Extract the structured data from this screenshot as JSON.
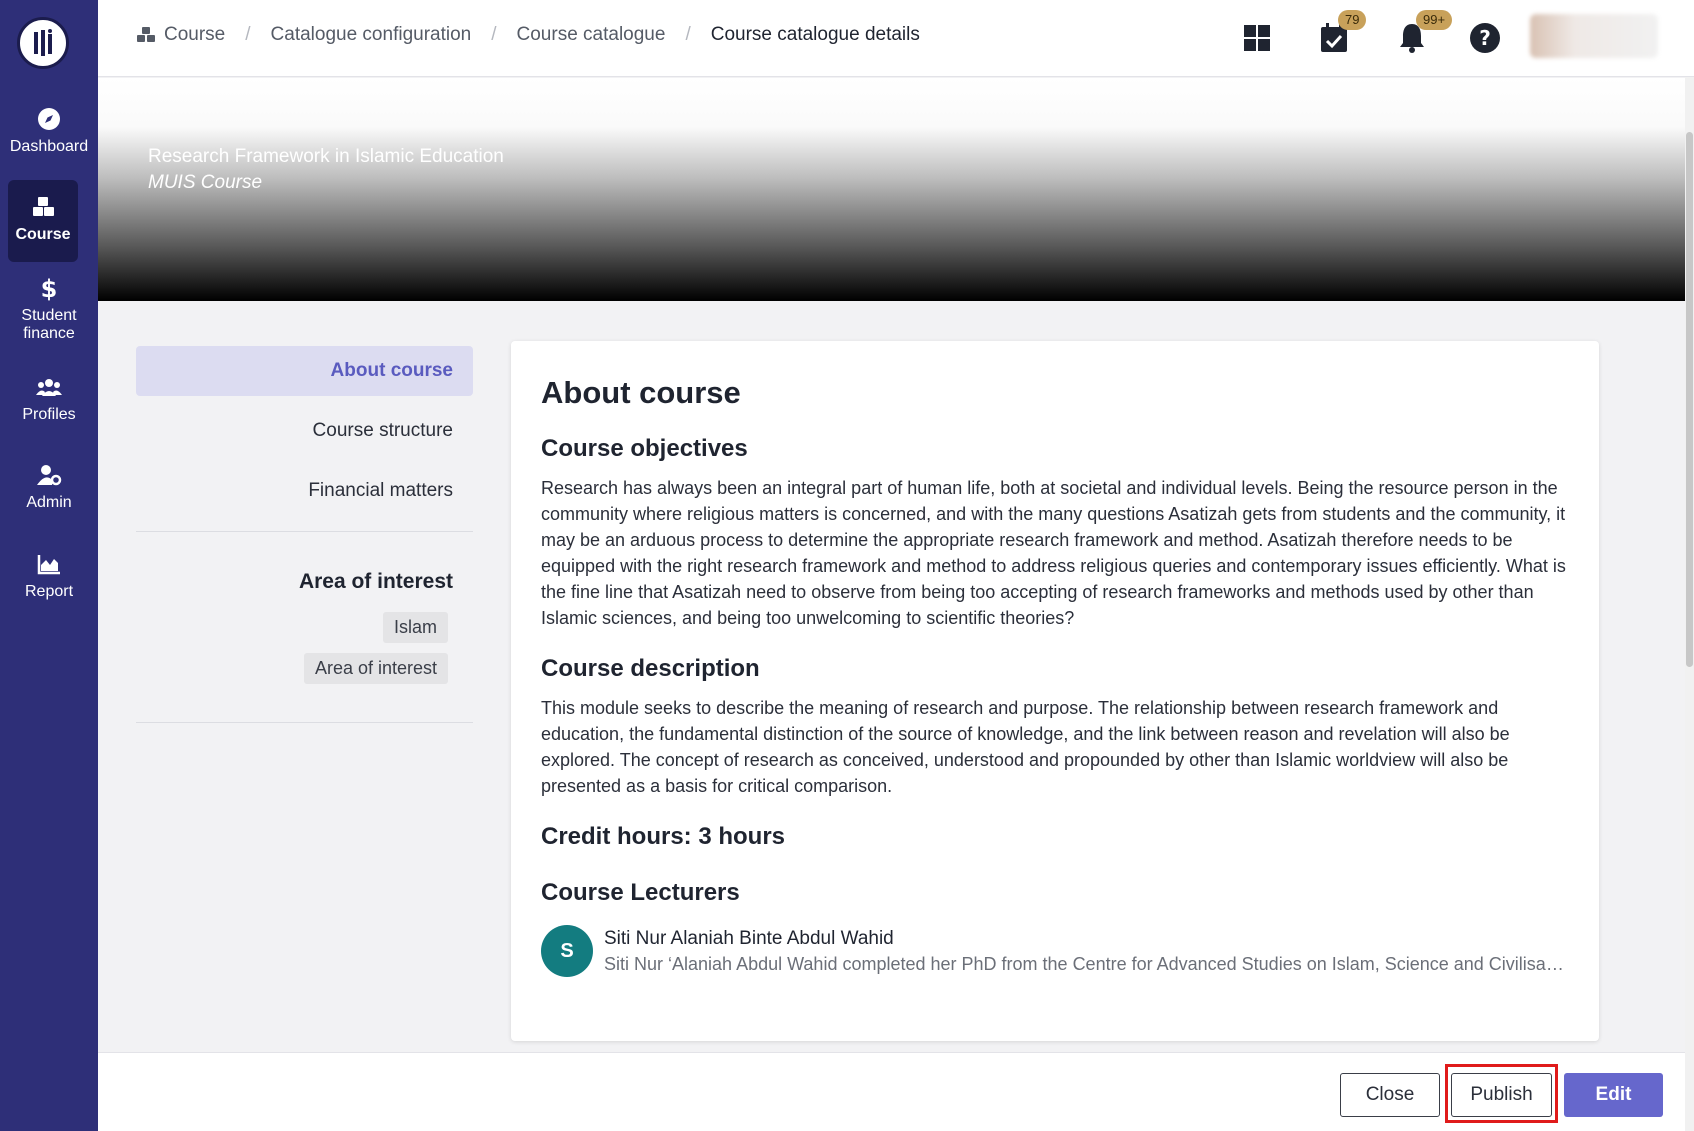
{
  "sidebar": {
    "items": [
      {
        "label": "Dashboard",
        "icon": "compass-icon"
      },
      {
        "label": "Course",
        "icon": "cubes-icon"
      },
      {
        "label": "Student finance",
        "icon": "dollar-icon"
      },
      {
        "label": "Profiles",
        "icon": "users-icon"
      },
      {
        "label": "Admin",
        "icon": "user-gear-icon"
      },
      {
        "label": "Report",
        "icon": "area-chart-icon"
      }
    ],
    "active": "Course"
  },
  "breadcrumb": {
    "items": [
      "Course",
      "Catalogue configuration",
      "Course catalogue"
    ],
    "current": "Course catalogue details"
  },
  "header": {
    "tasks_badge": "79",
    "notifications_badge": "99+"
  },
  "banner": {
    "title": "Research Framework in Islamic Education",
    "subtitle": "MUIS Course"
  },
  "section_nav": {
    "items": [
      "About course",
      "Course structure",
      "Financial matters"
    ],
    "active": "About course",
    "area_of_interest_title": "Area of interest",
    "tags": [
      "Islam",
      "Area of interest"
    ]
  },
  "main": {
    "heading": "About course",
    "objectives_title": "Course objectives",
    "objectives_text": "Research has always been an integral part of human life, both at societal and individual levels. Being the resource person in the community where religious matters is concerned, and with the many questions Asatizah gets from students and the community, it may be an arduous process to determine the appropriate research framework and method. Asatizah therefore needs to be equipped with the right research framework and method to address religious queries and contemporary issues efficiently. What is the fine line that Asatizah need to observe from being too accepting of research frameworks and methods used by other than Islamic sciences, and being too unwelcoming to scientific theories?",
    "description_title": "Course description",
    "description_text": "This module seeks to describe the meaning of research and purpose. The relationship between research framework and education, the fundamental distinction of the source of knowledge, and the link between reason and revelation will also be explored. The concept of research as conceived, understood and propounded by other than Islamic worldview will also be presented as a basis for critical comparison.",
    "credit_hours": "Credit hours: 3 hours",
    "lecturers_title": "Course Lecturers",
    "lecturer": {
      "initial": "S",
      "name": "Siti Nur Alaniah Binte Abdul Wahid",
      "bio": "Siti Nur ‘Alaniah Abdul Wahid completed her PhD from the Centre for Advanced Studies on Islam, Science and Civilisation"
    }
  },
  "footer": {
    "close_label": "Close",
    "publish_label": "Publish",
    "edit_label": "Edit"
  },
  "colors": {
    "sidebar": "#2e2f78",
    "accent": "#6667cc",
    "highlight": "#e01b1b"
  }
}
